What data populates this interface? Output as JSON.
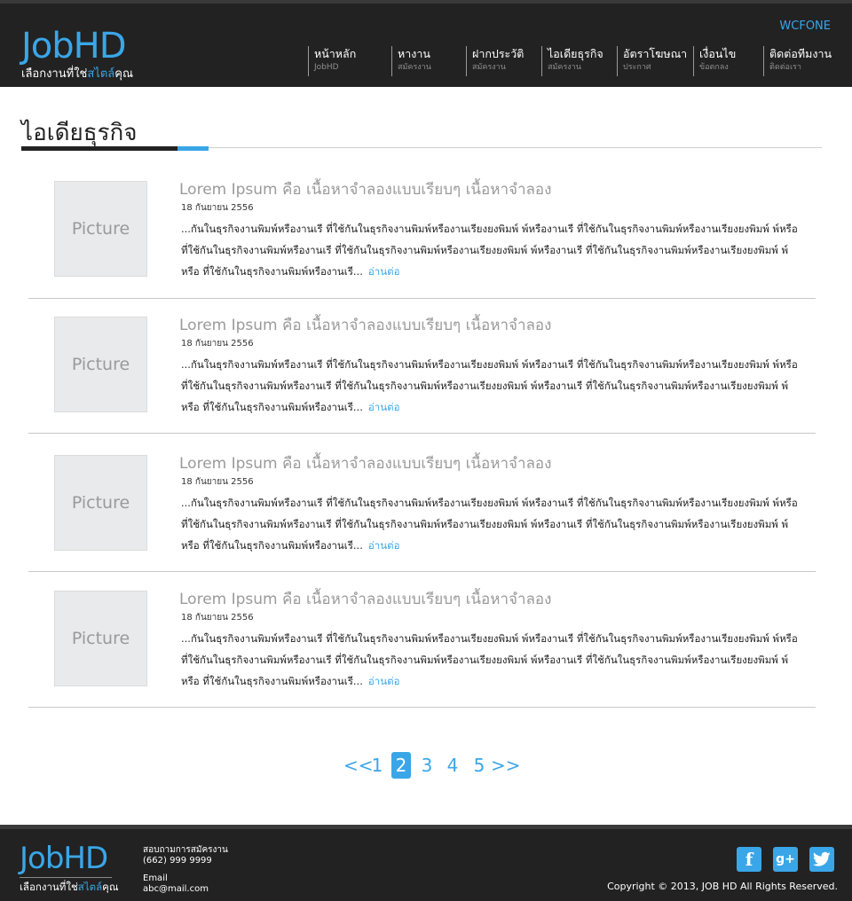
{
  "header": {
    "logo": "JobHD",
    "tagline_pre": "เลือกงานที่ใช่",
    "tagline_accent": "สไตล์",
    "tagline_post": "คุณ",
    "top_link": "WCFONE",
    "nav": [
      {
        "label": "หน้าหลัก",
        "sub": "JobHD"
      },
      {
        "label": "หางาน",
        "sub": "สมัครงาน"
      },
      {
        "label": "ฝากประวัติ",
        "sub": "สมัครงาน"
      },
      {
        "label": "ไอเดียธุรกิจ",
        "sub": "สมัครงาน"
      },
      {
        "label": "อัตราโฆษณา",
        "sub": "ประกาศ"
      },
      {
        "label": "เงื่อนไข",
        "sub": "ข้อตกลง"
      },
      {
        "label": "ติดต่อทีมงาน",
        "sub": "ติดต่อเรา"
      }
    ]
  },
  "page": {
    "title": "ไอเดียธุรกิจ"
  },
  "articles": [
    {
      "thumb": "Picture",
      "title": "Lorem Ipsum คือ เนื้อหาจำลองแบบเรียบๆ เนื้อหาจำลอง",
      "date": "18 กันยายน 2556",
      "excerpt": "...กันในธุรกิจงานพิมพ์หรืองานเรี ที่ใช้กันในธุรกิจงานพิมพ์หรืองานเรียงยงพิมพ์ พ์หรืองานเรี ที่ใช้กันในธุรกิจงานพิมพ์หรืองานเรียงยงพิมพ์ พ์หรือ ที่ใช้กันในธุรกิจงานพิมพ์หรืองานเรี ที่ใช้กันในธุรกิจงานพิมพ์หรืองานเรียงยงพิมพ์ พ์หรืองานเรี ที่ใช้กันในธุรกิจงานพิมพ์หรืองานเรียงยงพิมพ์ พ์หรือ ที่ใช้กันในธุรกิจงานพิมพ์หรืองานเรี...",
      "read_more": "อ่านต่อ"
    },
    {
      "thumb": "Picture",
      "title": "Lorem Ipsum คือ เนื้อหาจำลองแบบเรียบๆ เนื้อหาจำลอง",
      "date": "18 กันยายน 2556",
      "excerpt": "...กันในธุรกิจงานพิมพ์หรืองานเรี ที่ใช้กันในธุรกิจงานพิมพ์หรืองานเรียงยงพิมพ์ พ์หรืองานเรี ที่ใช้กันในธุรกิจงานพิมพ์หรืองานเรียงยงพิมพ์ พ์หรือ ที่ใช้กันในธุรกิจงานพิมพ์หรืองานเรี ที่ใช้กันในธุรกิจงานพิมพ์หรืองานเรียงยงพิมพ์ พ์หรืองานเรี ที่ใช้กันในธุรกิจงานพิมพ์หรืองานเรียงยงพิมพ์ พ์หรือ ที่ใช้กันในธุรกิจงานพิมพ์หรืองานเรี...",
      "read_more": "อ่านต่อ"
    },
    {
      "thumb": "Picture",
      "title": "Lorem Ipsum คือ เนื้อหาจำลองแบบเรียบๆ เนื้อหาจำลอง",
      "date": "18 กันยายน 2556",
      "excerpt": "...กันในธุรกิจงานพิมพ์หรืองานเรี ที่ใช้กันในธุรกิจงานพิมพ์หรืองานเรียงยงพิมพ์ พ์หรืองานเรี ที่ใช้กันในธุรกิจงานพิมพ์หรืองานเรียงยงพิมพ์ พ์หรือ ที่ใช้กันในธุรกิจงานพิมพ์หรืองานเรี ที่ใช้กันในธุรกิจงานพิมพ์หรืองานเรียงยงพิมพ์ พ์หรืองานเรี ที่ใช้กันในธุรกิจงานพิมพ์หรืองานเรียงยงพิมพ์ พ์หรือ ที่ใช้กันในธุรกิจงานพิมพ์หรืองานเรี...",
      "read_more": "อ่านต่อ"
    },
    {
      "thumb": "Picture",
      "title": "Lorem Ipsum คือ เนื้อหาจำลองแบบเรียบๆ เนื้อหาจำลอง",
      "date": "18 กันยายน 2556",
      "excerpt": "...กันในธุรกิจงานพิมพ์หรืองานเรี ที่ใช้กันในธุรกิจงานพิมพ์หรืองานเรียงยงพิมพ์ พ์หรืองานเรี ที่ใช้กันในธุรกิจงานพิมพ์หรืองานเรียงยงพิมพ์ พ์หรือ ที่ใช้กันในธุรกิจงานพิมพ์หรืองานเรี ที่ใช้กันในธุรกิจงานพิมพ์หรืองานเรียงยงพิมพ์ พ์หรืองานเรี ที่ใช้กันในธุรกิจงานพิมพ์หรืองานเรียงยงพิมพ์ พ์หรือ ที่ใช้กันในธุรกิจงานพิมพ์หรืองานเรี...",
      "read_more": "อ่านต่อ"
    }
  ],
  "pagination": {
    "prev": "<<",
    "pages": [
      "1",
      "2",
      "3",
      "4",
      "5"
    ],
    "current": "2",
    "next": ">>"
  },
  "footer": {
    "logo": "JobHD",
    "tagline_pre": "เลือกงานที่ใช่",
    "tagline_accent": "สไตล์",
    "tagline_post": "คุณ",
    "contact_label": "สอบถามการสมัครงาน",
    "phone": "(662) 999 9999",
    "email_label": "Email",
    "email": "abc@mail.com",
    "social": [
      {
        "icon": "facebook-icon",
        "glyph": "f"
      },
      {
        "icon": "google-plus-icon",
        "glyph": "g+"
      },
      {
        "icon": "twitter-icon",
        "glyph": "t"
      }
    ],
    "copyright": "Copyright © 2013, JOB HD All Rights Reserved."
  },
  "colors": {
    "accent": "#3aa6e8",
    "header_bg": "#222222",
    "thumb_bg": "#e9eaec"
  }
}
